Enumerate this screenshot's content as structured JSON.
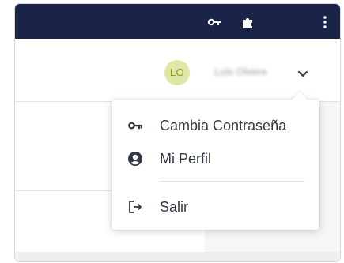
{
  "topbar": {
    "icons": [
      "key-icon",
      "puzzle-icon",
      "kebab-menu-icon"
    ],
    "background": "#1a2348"
  },
  "header": {
    "avatar_initials": "LO",
    "user_name": "Luis Olvera"
  },
  "menu": {
    "items": [
      {
        "label": "Cambia Contraseña",
        "icon": "key-icon"
      },
      {
        "label": "Mi Perfil",
        "icon": "user-circle-icon"
      },
      {
        "label": "Salir",
        "icon": "logout-icon"
      }
    ]
  },
  "colors": {
    "avatar_bg": "#dfe7a6",
    "avatar_text": "#8a9a1e",
    "menu_text": "#333a45"
  }
}
